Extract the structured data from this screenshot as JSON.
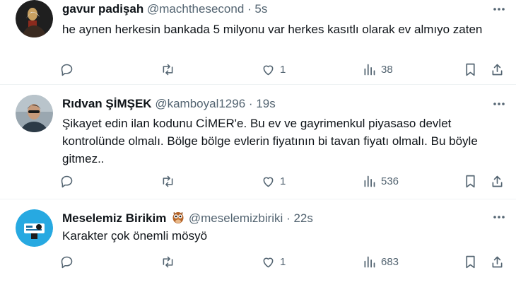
{
  "tweets": [
    {
      "name": "gavur padişah",
      "handle": "@machthesecond",
      "time": "5s",
      "text": "he aynen herkesin bankada 5 milyonu var herkes kasıtlı olarak ev almıyo zaten",
      "likes": "1",
      "views": "38",
      "avatar_color": "#1a1a1a"
    },
    {
      "name": "Rıdvan ŞİMŞEK",
      "handle": "@kamboyal1296",
      "time": "19s",
      "text": "Şikayet edin ilan kodunu CİMER'e. Bu ev ve gayrimenkul piyasaso devlet kontrolünde olmalı. Bölge bölge evlerin fiyatının bi tavan fiyatı olmalı. Bu böyle gitmez..",
      "likes": "1",
      "views": "536",
      "avatar_color": "#6b7c8a"
    },
    {
      "name": "Meselemiz Birikim",
      "handle": "@meselemizbiriki",
      "time": "22s",
      "text": "Karakter çok önemli mösyö",
      "likes": "1",
      "views": "683",
      "avatar_color": "#27a9e1"
    }
  ],
  "separator": "·",
  "colors": {
    "text": "#0f1419",
    "secondary": "#536471",
    "border": "#eff3f4"
  },
  "icons": [
    "more-icon",
    "reply-icon",
    "retweet-icon",
    "like-icon",
    "views-icon",
    "bookmark-icon",
    "share-icon",
    "owl-emoji"
  ]
}
